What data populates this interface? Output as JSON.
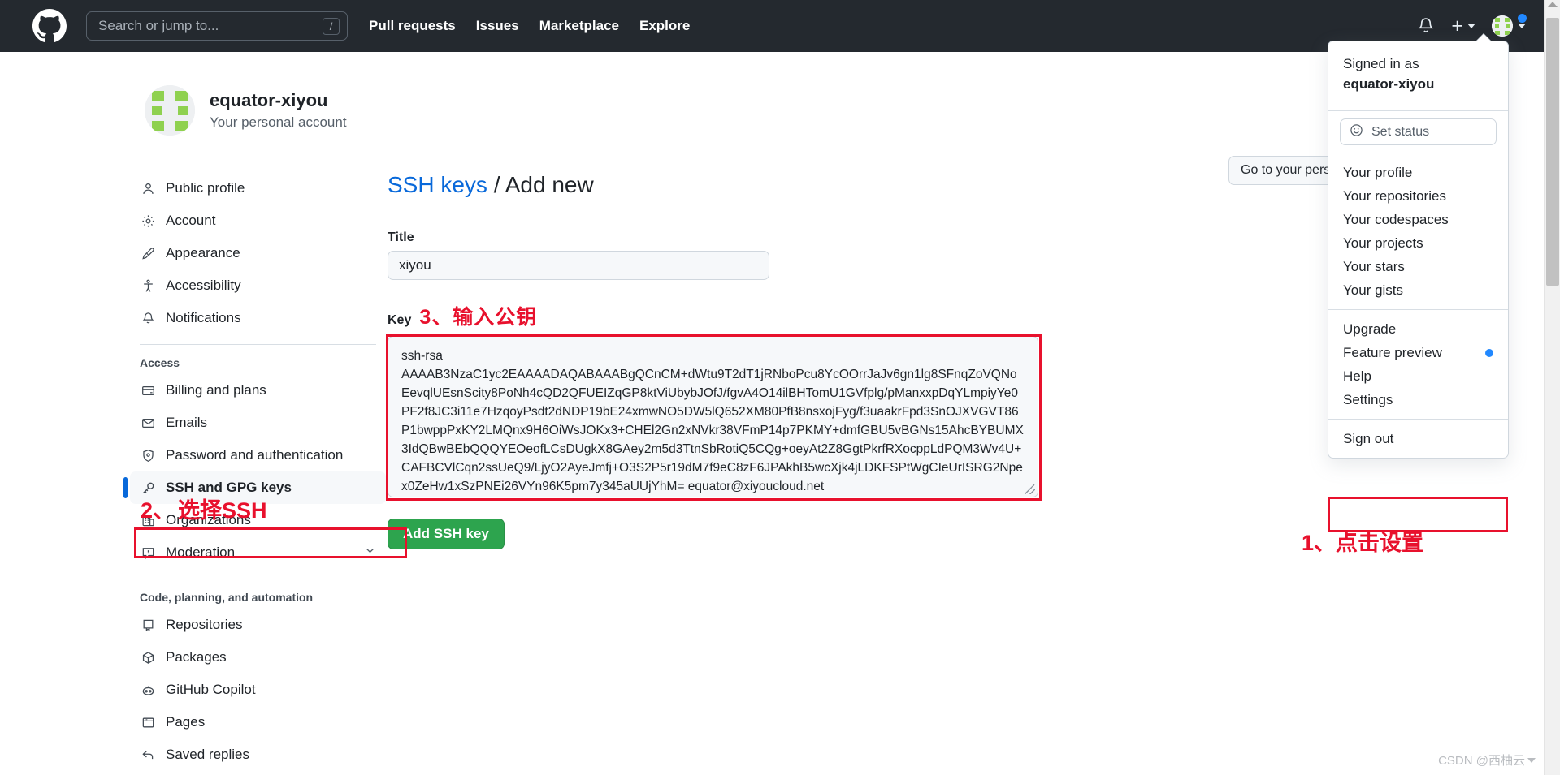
{
  "header": {
    "logo_icon": "github-mark-icon",
    "search": {
      "placeholder": "Search or jump to...",
      "shortcut_key": "/"
    },
    "nav": [
      {
        "label": "Pull requests"
      },
      {
        "label": "Issues"
      },
      {
        "label": "Marketplace"
      },
      {
        "label": "Explore"
      }
    ],
    "notifications_icon": "bell-icon",
    "create_new_icon": "plus-icon",
    "avatar_icon": "avatar-icon",
    "background_color": "#24292f"
  },
  "account": {
    "name": "equator-xiyou",
    "subtitle": "Your personal account",
    "go_personal_label": "Go to your pers"
  },
  "sidebar": {
    "groups": [
      {
        "heading": "",
        "items": [
          {
            "label": "Public profile",
            "icon": "person-icon",
            "current": false
          },
          {
            "label": "Account",
            "icon": "gear-icon",
            "current": false
          },
          {
            "label": "Appearance",
            "icon": "paintbrush-icon",
            "current": false
          },
          {
            "label": "Accessibility",
            "icon": "accessibility-icon",
            "current": false
          },
          {
            "label": "Notifications",
            "icon": "bell-icon",
            "current": false
          }
        ]
      },
      {
        "heading": "Access",
        "items": [
          {
            "label": "Billing and plans",
            "icon": "credit-card-icon",
            "current": false
          },
          {
            "label": "Emails",
            "icon": "mail-icon",
            "current": false
          },
          {
            "label": "Password and authentication",
            "icon": "shield-lock-icon",
            "current": false
          },
          {
            "label": "SSH and GPG keys",
            "icon": "key-icon",
            "current": true
          },
          {
            "label": "Organizations",
            "icon": "organization-icon",
            "current": false
          },
          {
            "label": "Moderation",
            "icon": "report-icon",
            "current": false,
            "expandable": true
          }
        ]
      },
      {
        "heading": "Code, planning, and automation",
        "items": [
          {
            "label": "Repositories",
            "icon": "repo-icon",
            "current": false
          },
          {
            "label": "Packages",
            "icon": "package-icon",
            "current": false
          },
          {
            "label": "GitHub Copilot",
            "icon": "copilot-icon",
            "current": false
          },
          {
            "label": "Pages",
            "icon": "browser-icon",
            "current": false
          },
          {
            "label": "Saved replies",
            "icon": "reply-icon",
            "current": false
          }
        ]
      }
    ]
  },
  "main": {
    "breadcrumb_link": "SSH keys",
    "breadcrumb_separator": "/",
    "breadcrumb_current": "Add new",
    "title_label": "Title",
    "title_value": "xiyou",
    "key_label": "Key",
    "key_value_line1": "ssh-rsa",
    "key_value_body": "AAAAB3NzaC1yc2EAAAADAQABAAABgQCnCM+dWtu9T2dT1jRNboPcu8YcOOrrJaJv6gn1lg8SFnqZoVQNoEevqlUEsnScity8PoNh4cQD2QFUEIZqGP8ktViUbybJOfJ/fgvA4O14ilBHTomU1GVfplg/pManxxpDqYLmpiyYe0PF2f8JC3i11e7HzqoyPsdt2dNDP19bE24xmwNO5DW5lQ652XM80PfB8nsxojFyg/f3uaakrFpd3SnOJXVGVT86P1bwppPxKY2LMQnx9H6OiWsJOKx3+CHEl2Gn2xNVkr38VFmP14p7PKMY+dmfGBU5vBGNs15AhcBYBUMX3IdQBwBEbQQQYEOeofLCsDUgkX8GAey2m5d3TtnSbRotiQ5CQg+oeyAt2Z8GgtPkrfRXocppLdPQM3Wv4U+CAFBCVlCqn2ssUeQ9/LjyO2AyeJmfj+O3S2P5r19dM7f9eC8zF6JPAkhB5wcXjk4jLDKFSPtWgCIeUrISRG2Npex0ZeHw1xSzPNEi26VYn96K5pm7y345aUUjYhM= equator@xiyoucloud.net",
    "submit_label": "Add SSH key"
  },
  "dropdown": {
    "signed_in_label": "Signed in as",
    "username": "equator-xiyou",
    "set_status_label": "Set status",
    "set_status_icon": "smiley-icon",
    "items_group1": [
      {
        "label": "Your profile"
      },
      {
        "label": "Your repositories"
      },
      {
        "label": "Your codespaces"
      },
      {
        "label": "Your projects"
      },
      {
        "label": "Your stars"
      },
      {
        "label": "Your gists"
      }
    ],
    "items_group2": [
      {
        "label": "Upgrade",
        "badge": false
      },
      {
        "label": "Feature preview",
        "badge": true
      },
      {
        "label": "Help",
        "badge": false
      },
      {
        "label": "Settings",
        "badge": false
      }
    ],
    "items_group3": [
      {
        "label": "Sign out"
      }
    ]
  },
  "annotations": {
    "step1": "1、点击设置",
    "step2_num": "2、",
    "step2_text": "选择SSH",
    "step3": "3、输入公钥",
    "highlight_color": "#e8112d"
  },
  "watermark": {
    "text": "CSDN @西柚云"
  }
}
